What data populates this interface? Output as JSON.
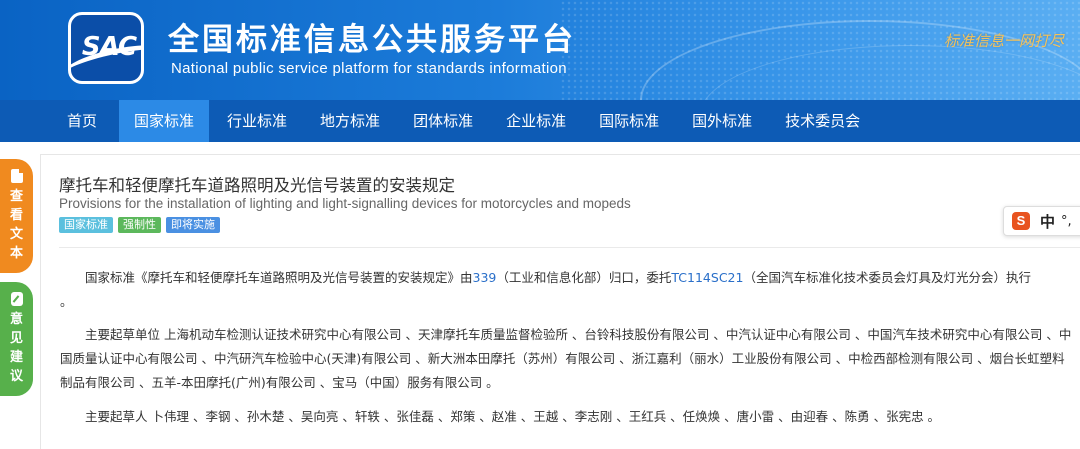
{
  "header": {
    "logo_text": "SAC",
    "title": "全国标准信息公共服务平台",
    "subtitle": "National public service platform  for standards information",
    "slogan": "标准信息一网打尽"
  },
  "nav": {
    "items": [
      {
        "label": "首页"
      },
      {
        "label": "国家标准"
      },
      {
        "label": "行业标准"
      },
      {
        "label": "地方标准"
      },
      {
        "label": "团体标准"
      },
      {
        "label": "企业标准"
      },
      {
        "label": "国际标准"
      },
      {
        "label": "国外标准"
      },
      {
        "label": "技术委员会"
      }
    ],
    "active_index": 1
  },
  "side": {
    "view_text": [
      "查",
      "看",
      "文",
      "本"
    ],
    "feedback": [
      "意",
      "见",
      "建",
      "议"
    ]
  },
  "standard": {
    "title_cn": "摩托车和轻便摩托车道路照明及光信号装置的安装规定",
    "title_en": "Provisions for the installation of lighting and light-signalling devices for motorcycles and mopeds",
    "tags": [
      "国家标准",
      "强制性",
      "即将实施"
    ]
  },
  "content": {
    "p1_prefix": "国家标准《摩托车和轻便摩托车道路照明及光信号装置的安装规定》由",
    "p1_link1": "339",
    "p1_mid": "（工业和信息化部）归口，委托",
    "p1_link2": "TC114SC21",
    "p1_suffix": "（全国汽车标准化技术委员会灯具及灯光分会）执行",
    "p1_end": "。",
    "p2": "主要起草单位 上海机动车检测认证技术研究中心有限公司 、天津摩托车质量监督检验所 、台铃科技股份有限公司 、中汽认证中心有限公司 、中国汽车技术研究中心有限公司 、中国质量认证中心有限公司 、中汽研汽车检验中心(天津)有限公司 、新大洲本田摩托（苏州）有限公司 、浙江嘉利（丽水）工业股份有限公司 、中检西部检测有限公司 、烟台长虹塑料制品有限公司 、五羊-本田摩托(广州)有限公司 、宝马（中国）服务有限公司 。",
    "p3": "主要起草人 卜伟理 、李钢 、孙木楚 、吴向亮 、轩轶 、张佳磊 、郑策 、赵准 、王越 、李志刚 、王红兵 、任焕焕 、唐小雷 、由迎春 、陈勇 、张宪忠 。"
  },
  "ime": {
    "logo": "S",
    "lang": "中",
    "punct": "°,"
  },
  "colors": {
    "nav_bg": "#0d5bb5",
    "nav_active": "#2c8ae6",
    "side_orange": "#f08a1f",
    "side_green": "#57b04b",
    "tag_national": "#5bc0de",
    "tag_mandatory": "#5cb85c",
    "tag_upcoming": "#4a90e2"
  }
}
